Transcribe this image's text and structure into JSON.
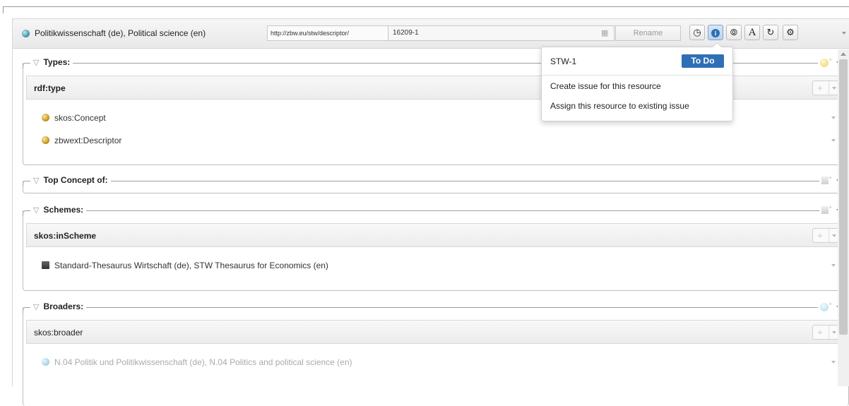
{
  "header": {
    "title": "Politikwissenschaft (de), Political science (en)",
    "uri": "http://zbw.eu/stw/descriptor/",
    "local_name": "16209-1",
    "rename_label": "Rename",
    "toggle_label": "A"
  },
  "sections": {
    "types": {
      "legend": "Types:",
      "property": "rdf:type",
      "values": [
        "skos:Concept",
        "zbwext:Descriptor"
      ]
    },
    "top_concept": {
      "legend": "Top Concept of:"
    },
    "schemes": {
      "legend": "Schemes:",
      "property": "skos:inScheme",
      "values": [
        "Standard-Thesaurus Wirtschaft (de), STW Thesaurus for Economics (en)"
      ]
    },
    "broaders": {
      "legend": "Broaders:",
      "property": "skos:broader",
      "values": [
        "N.04 Politik und Politikwissenschaft (de), N.04 Politics and political science (en)"
      ]
    }
  },
  "popup": {
    "issue_id": "STW-1",
    "status": "To Do",
    "items": [
      "Create issue for this resource",
      "Assign this resource to existing issue"
    ]
  },
  "colors": {
    "accent": "#2f6fb5",
    "status_badge": "#2f6fb5"
  }
}
